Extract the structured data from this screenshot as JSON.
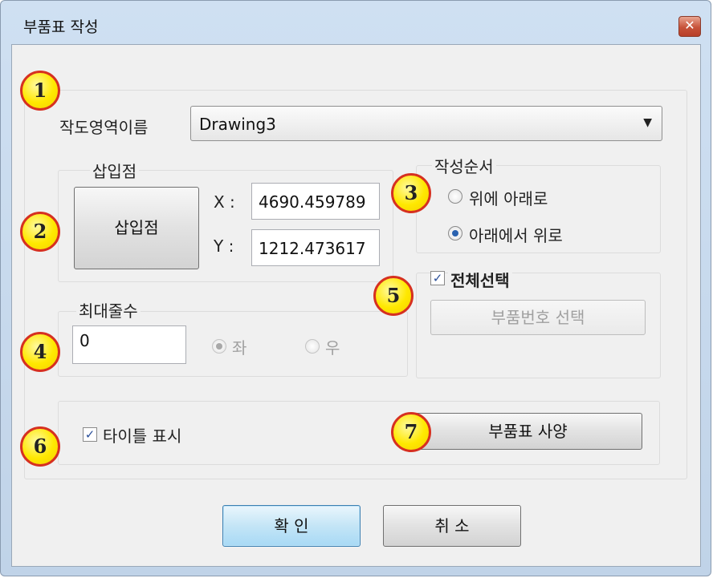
{
  "window": {
    "title": "부품표 작성",
    "close_glyph": "✕"
  },
  "drawing_area": {
    "label": "작도영역이름",
    "selected": "Drawing3"
  },
  "insert_point": {
    "group_label": "삽입점",
    "button_label": "삽입점",
    "x_label": "X :",
    "x_value": "4690.459789",
    "y_label": "Y :",
    "y_value": "1212.473617"
  },
  "order": {
    "group_label": "작성순서",
    "options": [
      "위에 아래로",
      "아래에서 위로"
    ],
    "selected": "아래에서 위로"
  },
  "max_rows": {
    "group_label": "최대줄수",
    "value": "0",
    "options": [
      "좌",
      "우"
    ],
    "selected": "좌"
  },
  "select_all": {
    "label": "전체선택",
    "checked": true
  },
  "part_number": {
    "button_label": "부품번호 선택"
  },
  "title_display": {
    "label": "타이틀 표시",
    "checked": true
  },
  "spec": {
    "button_label": "부품표 사양"
  },
  "footer": {
    "ok_label": "확 인",
    "cancel_label": "취 소"
  },
  "callouts": [
    "1",
    "2",
    "3",
    "4",
    "5",
    "6",
    "7"
  ],
  "colors": {
    "callout_fill": "#ffe800",
    "callout_border": "#d63020",
    "accent": "#2a62b0"
  }
}
